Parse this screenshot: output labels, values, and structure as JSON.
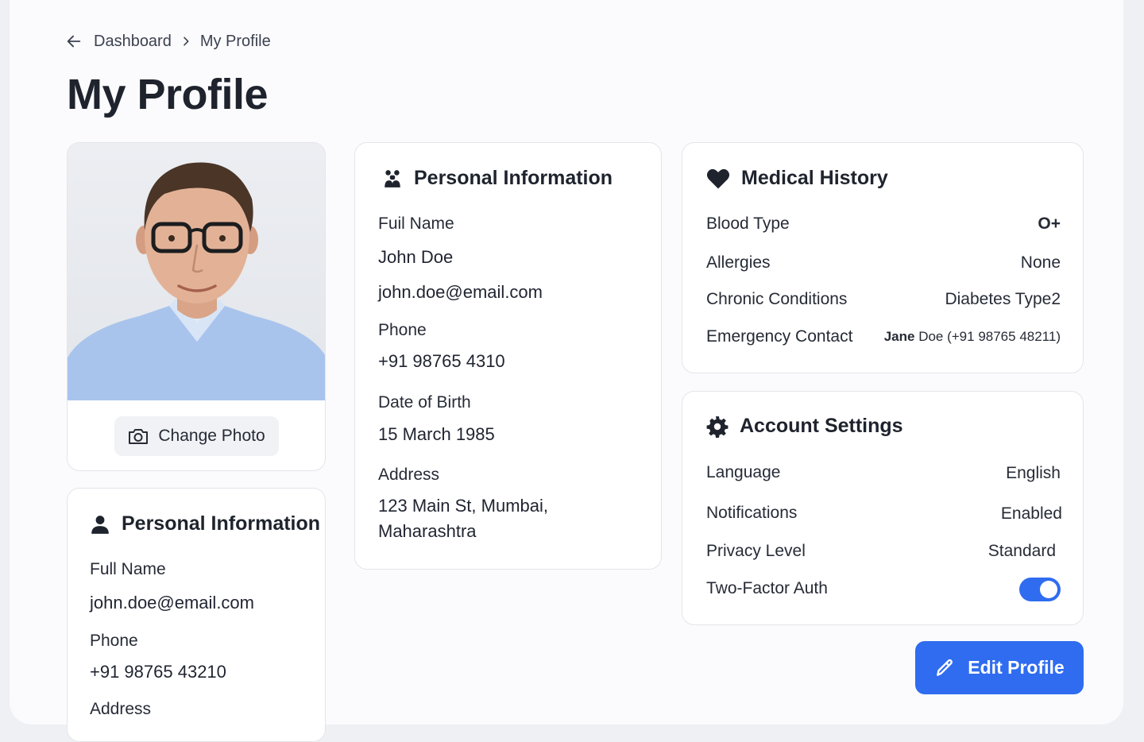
{
  "breadcrumb": {
    "back_icon": "arrow-left-icon",
    "items": [
      "Dashboard",
      "My Profile"
    ]
  },
  "page": {
    "title": "My Profile"
  },
  "photo_card": {
    "change_photo_label": "Change Photo",
    "icon": "camera-icon"
  },
  "personal_info_main": {
    "title": "Personal Information",
    "icon": "user-pair-icon",
    "full_name_label": "Fuil Name",
    "full_name": "John Doe",
    "email": "john.doe@email.com",
    "phone_label": "Phone",
    "phone": "+91 98765 4310",
    "dob_label": "Date of Birth",
    "dob": "15 March 1985",
    "address_label": "Address",
    "address_line1": "123 Main St, Mumbai,",
    "address_line2": "Maharashtra"
  },
  "personal_info_side": {
    "title": "Personal Information",
    "icon": "user-icon",
    "full_name_label": "Full Name",
    "email": "john.doe@email.com",
    "phone_label": "Phone",
    "phone": "+91 98765 43210",
    "address_label": "Address"
  },
  "medical_history": {
    "title": "Medical History",
    "icon": "heart-icon",
    "rows": [
      {
        "label": "Blood Type",
        "value": "O+"
      },
      {
        "label": "Allergies",
        "value": "None"
      },
      {
        "label": "Chronic Conditions",
        "value": "Diabetes Type2"
      },
      {
        "label": "Emergency Contact",
        "value_bold": "Jane",
        "value": "Doe (+91 98765 48211)"
      }
    ]
  },
  "account_settings": {
    "title": "Account Settings",
    "icon": "gear-icon",
    "rows": [
      {
        "label": "Language",
        "value": "English"
      },
      {
        "label": "Notifications",
        "value": "Enabled"
      },
      {
        "label": "Privacy Level",
        "value": "Standard"
      },
      {
        "label": "Two-Factor Auth",
        "toggle_on": true
      }
    ]
  },
  "actions": {
    "edit_profile_label": "Edit Profile",
    "edit_icon": "pencil-icon"
  },
  "colors": {
    "accent": "#2f6cf0",
    "text": "#1f2430",
    "card_border": "#e3e5ea"
  }
}
